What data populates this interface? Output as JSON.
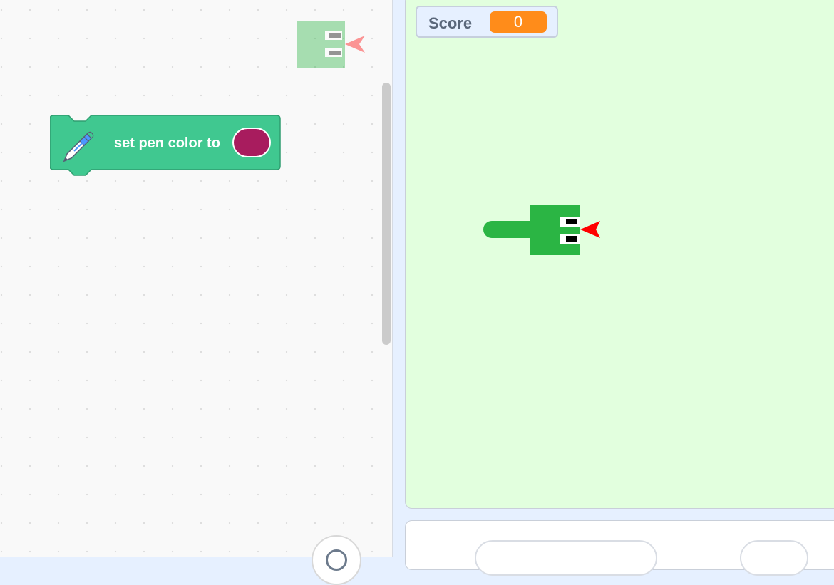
{
  "code_area": {
    "block": {
      "category": "pen",
      "icon": "pen-icon",
      "text": "set pen color to",
      "color_value": "#a81c5e",
      "block_color": "#40c890"
    }
  },
  "stage": {
    "monitor": {
      "label": "Score",
      "value": "0"
    },
    "sprite": {
      "name": "snake",
      "icon": "snake-sprite"
    }
  },
  "colors": {
    "stage_background": "#e2ffde",
    "monitor_value_background": "#ff8c1a",
    "snake_green": "#2bb544",
    "tongue_red": "#ff0000"
  }
}
